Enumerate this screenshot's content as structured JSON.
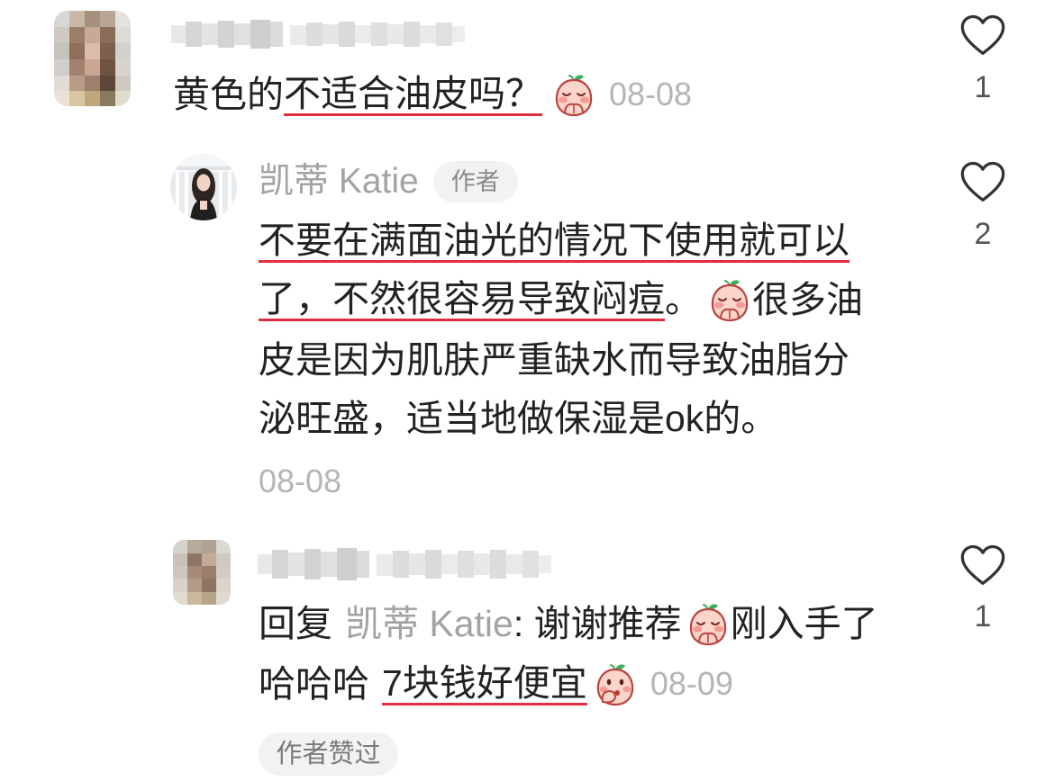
{
  "comments": [
    {
      "text_plain": "黄色的",
      "text_underlined": "不适合油皮吗？",
      "emoji": "shy-peach-emoji",
      "date": "08-08",
      "likes": "1",
      "replies": [
        {
          "author_name": "凯蒂 Katie",
          "author_tag": "作者",
          "line1_underlined": "不要在满面油光的情况下使用就可以",
          "line2_underlined": "了，不然很容易导致闷痘",
          "line2_punct": "。",
          "line2_emoji": "shy-peach-emoji",
          "line2_tail": "很多油",
          "line3": "皮是因为肌肤严重缺水而导致油脂分",
          "line4": "泌旺盛，适当地做保湿是ok的。",
          "date": "08-08",
          "likes": "2"
        },
        {
          "reply_prefix": "回复",
          "reply_to": "凯蒂 Katie",
          "line1_text": ": 谢谢推荐",
          "line1_emoji": "shy-peach-emoji",
          "line1_tail": "刚入手了",
          "line2_text": "哈哈哈",
          "line2_underlined": "7块钱好便宜",
          "line2_emoji": "covering-mouth-peach-emoji",
          "date": "08-09",
          "likes": "1",
          "badge": "作者赞过"
        }
      ]
    }
  ],
  "icons": {
    "like": "heart-outline-icon"
  },
  "colors": {
    "text": "#222222",
    "secondary": "#a3a3a3",
    "date": "#b5b5b5",
    "underline": "#e02e3c",
    "pill_bg": "#f2f2f2",
    "like_count": "#555555"
  }
}
